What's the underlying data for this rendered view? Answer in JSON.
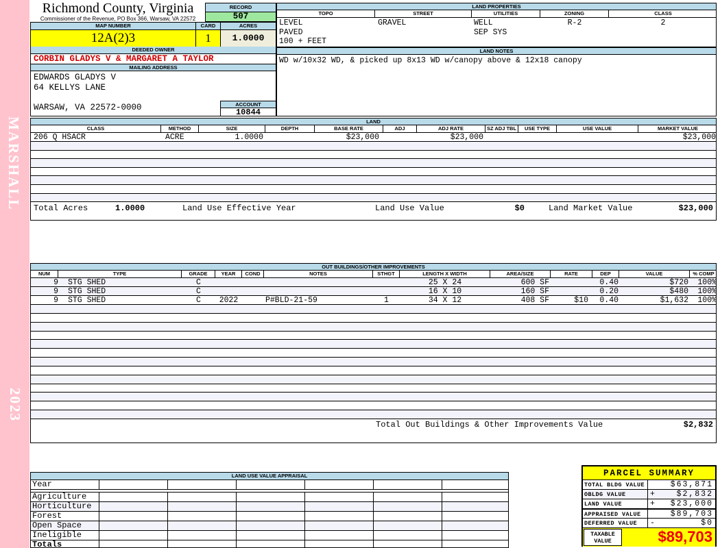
{
  "sidebar": {
    "brand": "MARSHALL",
    "year": "2023"
  },
  "header": {
    "title": "Richmond County, Virginia",
    "subtitle": "Commissioner of the Revenue, PO Box 366, Warsaw, VA 22572"
  },
  "record": {
    "label": "RECORD",
    "value": "507"
  },
  "map_number": {
    "label": "MAP NUMBER",
    "value": "12A(2)3"
  },
  "card": {
    "label": "CARD",
    "value": "1"
  },
  "acres": {
    "label": "ACRES",
    "value": "1.0000"
  },
  "owner": {
    "label": "DEEDED OWNER",
    "value": "CORBIN GLADYS V & MARGARET A TAYLOR"
  },
  "mailing": {
    "label": "MAILING ADDRESS",
    "line1": "EDWARDS GLADYS V",
    "line2": "64 KELLYS LANE",
    "line3": "WARSAW, VA 22572-0000"
  },
  "account": {
    "label": "ACCOUNT",
    "value": "10844"
  },
  "land_properties": {
    "title": "LAND PROPERTIES",
    "headers": [
      "TOPO",
      "STREET",
      "UTILITIES",
      "ZONING",
      "CLASS"
    ],
    "topo": [
      "LEVEL",
      "PAVED",
      "100 + FEET"
    ],
    "street": [
      "GRAVEL"
    ],
    "utilities": [
      "WELL",
      "SEP SYS"
    ],
    "zoning": "R-2",
    "class": "2"
  },
  "land_notes": {
    "title": "LAND NOTES",
    "text": "WD w/10x32 WD, & picked up 8x13 WD w/canopy above & 12x18 canopy"
  },
  "land": {
    "title": "LAND",
    "headers": [
      "CLASS",
      "METHOD",
      "SIZE",
      "DEPTH",
      "BASE RATE",
      "ADJ",
      "ADJ RATE",
      "SZ ADJ TBL",
      "USE TYPE",
      "USE VALUE",
      "MARKET VALUE"
    ],
    "row": {
      "class": "206 Q HSACR",
      "method": "ACRE",
      "size": "1.0000",
      "depth": "",
      "base_rate": "$23,000",
      "adj": "",
      "adj_rate": "$23,000",
      "sz_adj_tbl": "",
      "use_type": "",
      "use_value": "",
      "market_value": "$23,000"
    },
    "summary": {
      "total_acres_label": "Total Acres",
      "total_acres": "1.0000",
      "effective_year_label": "Land Use Effective Year",
      "use_value_label": "Land Use Value",
      "use_value": "$0",
      "market_label": "Land Market Value",
      "market_value": "$23,000"
    }
  },
  "out_buildings": {
    "title": "OUT BUILDINGS/OTHER IMPROVEMENTS",
    "headers": [
      "NUM",
      "TYPE",
      "GRADE",
      "YEAR",
      "COND",
      "NOTES",
      "STHGT",
      "LENGTH X WIDTH",
      "AREA/SIZE",
      "RATE",
      "DEP",
      "VALUE",
      "% COMP"
    ],
    "rows": [
      {
        "num": "9",
        "type": "STG SHED",
        "grade": "C",
        "year": "",
        "cond": "",
        "notes": "",
        "sthgt": "",
        "lxw": "25 X 24",
        "area": "600 SF",
        "rate": "",
        "dep": "0.40",
        "value": "$720",
        "comp": "100%"
      },
      {
        "num": "9",
        "type": "STG SHED",
        "grade": "C",
        "year": "",
        "cond": "",
        "notes": "",
        "sthgt": "",
        "lxw": "16 X 10",
        "area": "160 SF",
        "rate": "",
        "dep": "0.20",
        "value": "$480",
        "comp": "100%"
      },
      {
        "num": "9",
        "type": "STG SHED",
        "grade": "C",
        "year": "2022",
        "cond": "",
        "notes": "P#BLD-21-59",
        "sthgt": "1",
        "lxw": "34 X 12",
        "area": "408 SF",
        "rate": "$10",
        "dep": "0.40",
        "value": "$1,632",
        "comp": "100%"
      }
    ],
    "total_label": "Total Out Buildings & Other Improvements Value",
    "total_value": "$2,832"
  },
  "land_use_appraisal": {
    "title": "LAND USE VALUE APPRAISAL",
    "row_labels": [
      "Year",
      "Agriculture",
      "Horticulture",
      "Forest",
      "Open Space",
      "Ineligible",
      "Totals"
    ]
  },
  "parcel_summary": {
    "title": "PARCEL SUMMARY",
    "rows": [
      {
        "label": "TOTAL BLDG VALUE",
        "op": "",
        "value": "$63,871"
      },
      {
        "label": "OBLDG VALUE",
        "op": "+",
        "value": "$2,832"
      },
      {
        "label": "LAND VALUE",
        "op": "+",
        "value": "$23,000"
      },
      {
        "label": "APPRAISED VALUE",
        "op": "",
        "value": "$89,703"
      },
      {
        "label": "DEFERRED VALUE",
        "op": "-",
        "value": "$0"
      }
    ],
    "taxable_label": "TAXABLE VALUE",
    "taxable_value": "$89,703"
  },
  "colors": {
    "accent_pink": "#ffc3ce",
    "header_blue": "#b8dae9",
    "record_green": "#9ee79e",
    "highlight_yellow": "#ffff00",
    "value_cream": "#efeedd",
    "owner_red": "#cf0000",
    "taxable_red": "#ef0000",
    "row_stripe": "#f3f3fb"
  }
}
